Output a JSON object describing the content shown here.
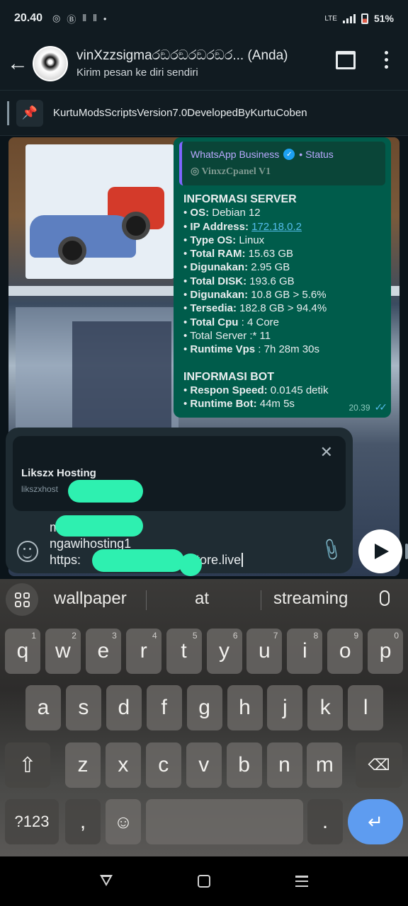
{
  "status_bar": {
    "time": "20.40",
    "battery": "51%",
    "network": "LTE"
  },
  "header": {
    "title": "vinXzzsigmaරඞරඞරඞරඞර... (Anda)",
    "subtitle": "Kirim pesan ke diri sendiri"
  },
  "pinned": {
    "text": "KurtuModsScriptsVersion7.0DevelopedByKurtuCoben"
  },
  "message": {
    "quote_source": "WhatsApp Business",
    "quote_status": "• Status",
    "quote_name": "VinxzCpanel V1",
    "server_heading": "INFORMASI SERVER",
    "lines": [
      {
        "bullet": "• ",
        "label": "OS:",
        "value": " Debian 12"
      },
      {
        "bullet": "• ",
        "label": "IP Address:",
        "value": " ",
        "link": "172.18.0.2"
      },
      {
        "bullet": "• ",
        "label": "Type OS:",
        "value": " Linux"
      },
      {
        "bullet": "• ",
        "label": "Total RAM:",
        "value": " 15.63 GB"
      },
      {
        "bullet": "• ",
        "label": "Digunakan:",
        "value": " 2.95 GB"
      },
      {
        "bullet": "• ",
        "label": "Total DISK:",
        "value": " 193.6 GB"
      },
      {
        "bullet": "• ",
        "label": "Digunakan:",
        "value": " 10.8 GB > 5.6%"
      },
      {
        "bullet": "• ",
        "label": "Tersedia:",
        "value": " 182.8 GB > 94.4%"
      },
      {
        "bullet": "• ",
        "label": "Total Cpu",
        "value": " : 4 Core"
      },
      {
        "bullet": "• ",
        "label": "",
        "value": "Total Server :* 11"
      },
      {
        "bullet": "• ",
        "label": "Runtime Vps",
        "value": " : 7h 28m 30s"
      }
    ],
    "bot_heading": "INFORMASI BOT",
    "bot_lines": [
      {
        "bullet": "• ",
        "label": "Respon Speed:",
        "value": " 0.0145 detik"
      },
      {
        "bullet": "• ",
        "label": "Runtime Bot:",
        "value": " 44m 5s"
      }
    ],
    "time": "20.39"
  },
  "composer": {
    "preview_title": "Likszx Hosting",
    "preview_url": "likszxhost",
    "input_lines": [
      "m",
      "ngawihosting1",
      "https:",
      "dastore.live"
    ]
  },
  "keyboard": {
    "suggestions": [
      "wallpaper",
      "at",
      "streaming"
    ],
    "row1": [
      [
        "q",
        "1"
      ],
      [
        "w",
        "2"
      ],
      [
        "e",
        "3"
      ],
      [
        "r",
        "4"
      ],
      [
        "t",
        "5"
      ],
      [
        "y",
        "6"
      ],
      [
        "u",
        "7"
      ],
      [
        "i",
        "8"
      ],
      [
        "o",
        "9"
      ],
      [
        "p",
        "0"
      ]
    ],
    "row2": [
      "a",
      "s",
      "d",
      "f",
      "g",
      "h",
      "j",
      "k",
      "l"
    ],
    "row3": [
      "z",
      "x",
      "c",
      "v",
      "b",
      "n",
      "m"
    ],
    "symbols_label": "?123",
    "comma": ",",
    "period": "."
  }
}
